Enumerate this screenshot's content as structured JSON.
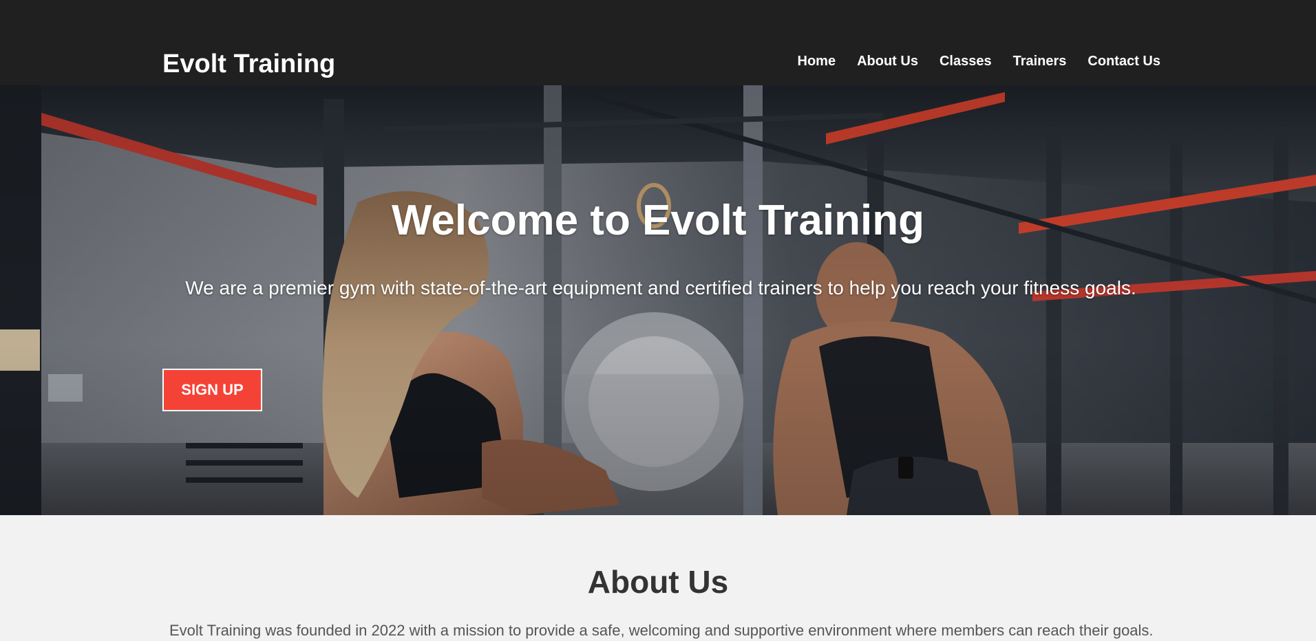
{
  "header": {
    "brand": "Evolt Training",
    "nav": [
      {
        "label": "Home"
      },
      {
        "label": "About Us"
      },
      {
        "label": "Classes"
      },
      {
        "label": "Trainers"
      },
      {
        "label": "Contact Us"
      }
    ]
  },
  "hero": {
    "title": "Welcome to Evolt Training",
    "subtitle": "We are a premier gym with state-of-the-art equipment and certified trainers to help you reach your fitness goals.",
    "cta_label": "SIGN UP",
    "image": "gym-training-photo"
  },
  "about": {
    "title": "About Us",
    "text": "Evolt Training was founded in 2022 with a mission to provide a safe, welcoming and supportive environment where members can reach their goals."
  },
  "colors": {
    "header_bg": "#202020",
    "accent": "#f44336",
    "page_bg": "#f2f2f2",
    "heading": "#333333"
  }
}
